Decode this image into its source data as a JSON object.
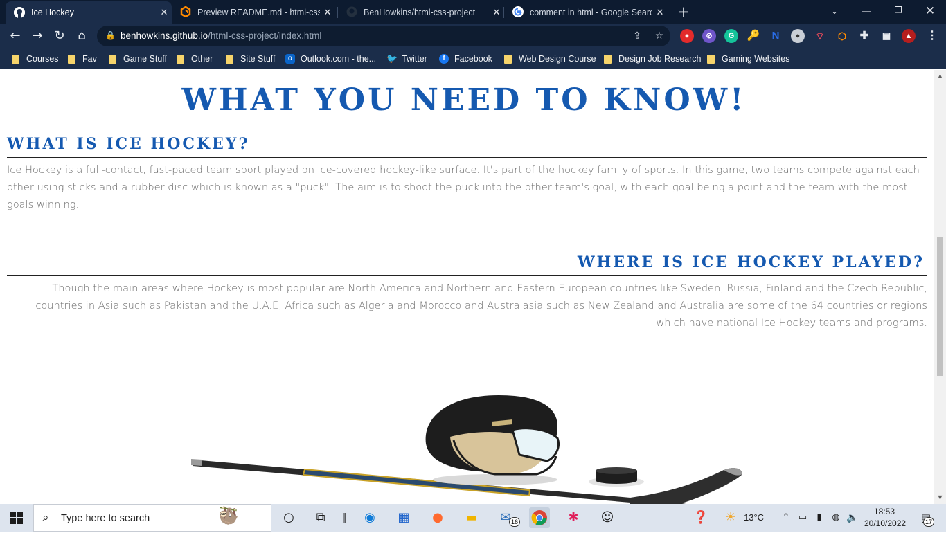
{
  "browser": {
    "tabs": [
      {
        "title": "Ice Hockey",
        "icon": "github-icon",
        "active": true
      },
      {
        "title": "Preview README.md - html-css-p",
        "icon": "gitpod-icon",
        "active": false
      },
      {
        "title": "BenHowkins/html-css-project",
        "icon": "github-icon",
        "active": false
      },
      {
        "title": "comment in html - Google Search",
        "icon": "google-icon",
        "active": false
      }
    ],
    "url_host": "benhowkins.github.io",
    "url_path": "/html-css-project/index.html",
    "bookmarks": [
      {
        "label": "Courses",
        "icon": "folder"
      },
      {
        "label": "Fav",
        "icon": "folder"
      },
      {
        "label": "Game Stuff",
        "icon": "folder"
      },
      {
        "label": "Other",
        "icon": "folder"
      },
      {
        "label": "Site Stuff",
        "icon": "folder"
      },
      {
        "label": "Outlook.com - the...",
        "icon": "outlook-icon"
      },
      {
        "label": "Twitter",
        "icon": "twitter-icon"
      },
      {
        "label": "Facebook",
        "icon": "facebook-icon"
      },
      {
        "label": "Web Design Course",
        "icon": "folder"
      },
      {
        "label": "Design Job Research",
        "icon": "folder"
      },
      {
        "label": "Gaming Websites",
        "icon": "folder"
      }
    ]
  },
  "page": {
    "title": "WHAT YOU NEED TO KNOW!",
    "section1": {
      "heading": "WHAT IS ICE HOCKEY?",
      "text": "Ice Hockey is a full-contact, fast-paced team sport played on ice-covered hockey-like surface. It's part of the hockey family of sports. In this game, two teams compete against each other using sticks and a rubber disc which is known as a \"puck\". The aim is to shoot the puck into the other team's goal, with each goal being a point and the team with the most goals winning."
    },
    "section2": {
      "heading": "WHERE IS ICE HOCKEY PLAYED?",
      "text": "Though the main areas where Hockey is most popular are North America and Northern and Eastern European countries like Sweden, Russia, Finland and the Czech Republic, countries in Asia such as Pakistan and the U.A.E, Africa such as Algeria and Morocco and Australasia such as New Zealand and Australia are some of the 64 countries or regions which have national Ice Hockey teams and programs."
    }
  },
  "taskbar": {
    "search_placeholder": "Type here to search",
    "weather": "13°C",
    "time": "18:53",
    "date": "20/10/2022",
    "mail_badge": "16",
    "notif_badge": "17"
  }
}
